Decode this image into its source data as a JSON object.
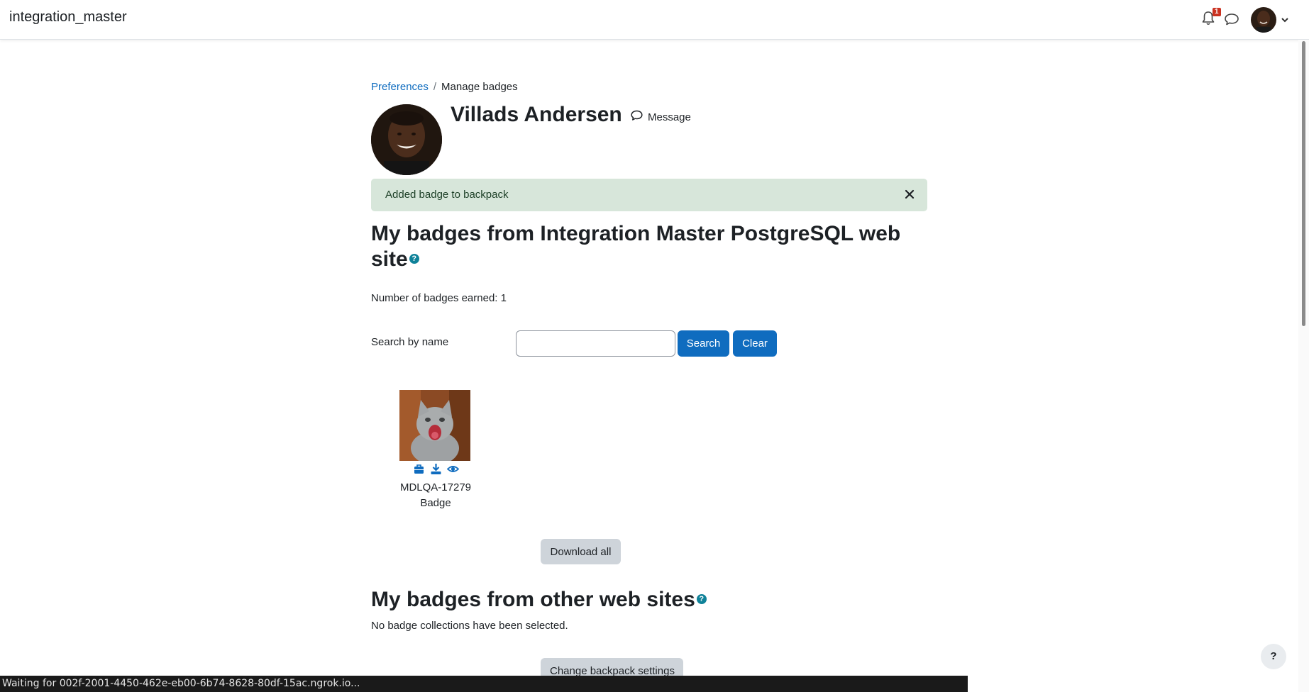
{
  "navbar": {
    "brand": "integration_master",
    "notification_count": "1"
  },
  "breadcrumb": {
    "parent": "Preferences",
    "separator": "/",
    "current": "Manage badges"
  },
  "profile": {
    "name": "Villads Andersen",
    "message_label": "Message"
  },
  "alert": {
    "text": "Added badge to backpack",
    "close_glyph": "✕"
  },
  "site_badges": {
    "title": "My badges from Integration Master PostgreSQL web site",
    "help_glyph": "?",
    "count_text": "Number of badges earned: 1",
    "search_label": "Search by name",
    "search_value": "",
    "search_button": "Search",
    "clear_button": "Clear",
    "badges": [
      {
        "name_line1": "MDLQA-17279",
        "name_line2": "Badge"
      }
    ],
    "download_all": "Download all"
  },
  "other_badges": {
    "title": "My badges from other web sites",
    "help_glyph": "?",
    "empty_text": "No badge collections have been selected.",
    "change_settings": "Change backpack settings"
  },
  "floating_help": "?",
  "status_bar": "Waiting for 002f-2001-4450-462e-eb00-6b74-8628-80df-15ac.ngrok.io...",
  "colors": {
    "link": "#0f6cbf",
    "primary_button": "#0f6cbf",
    "alert_bg": "#d7e6da",
    "help_icon": "#0f8299",
    "notification_badge": "#ca3120"
  }
}
